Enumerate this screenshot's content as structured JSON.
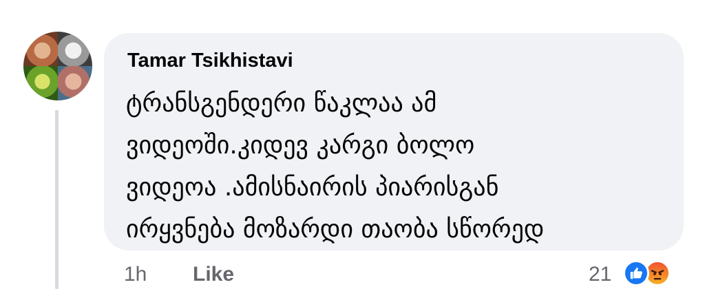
{
  "comment": {
    "author": "Tamar Tsikhistavi",
    "lines": [
      "ტრანსგენდერი წაკლაა ამ",
      "ვიდეოში.კიდევ კარგი ბოლო",
      "ვიდეოა .ამისნაირის პიარისგან",
      "ირყვნება მოზარდი თაობა სწორედ"
    ]
  },
  "footer": {
    "time": "1h",
    "like_label": "Like",
    "reaction_count": "21",
    "reactions": [
      "like-icon",
      "angry-icon"
    ]
  },
  "colors": {
    "bubble": "#f0f2f5",
    "text": "#050505",
    "secondary": "#65676b",
    "like_blue": "#1877f2",
    "angry_orange": "#f0522f"
  }
}
